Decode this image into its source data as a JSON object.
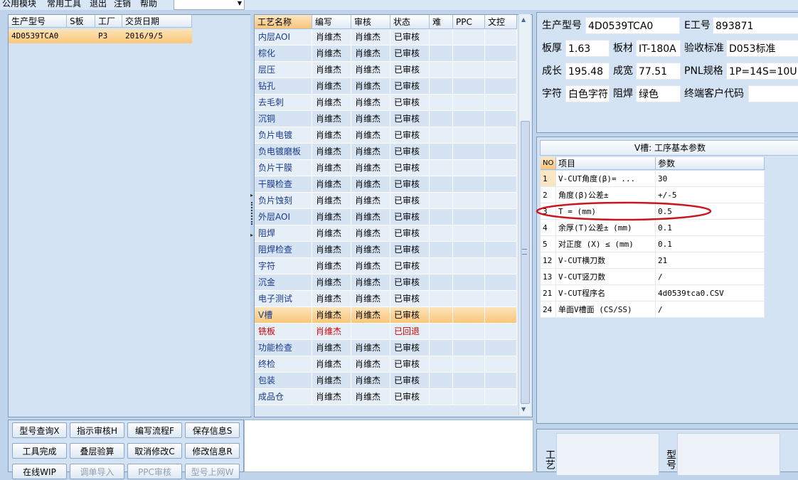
{
  "menubar": {
    "items": [
      "公用模块",
      "常用工具",
      "退出",
      "注销",
      "帮助"
    ],
    "combo_value": ""
  },
  "left_grid": {
    "headers": [
      "生产型号",
      "S板",
      "工厂",
      "交货日期"
    ],
    "rows": [
      {
        "model": "4D0539TCA0",
        "s": "",
        "factory": "P3",
        "date": "2016/9/5"
      }
    ]
  },
  "process_grid": {
    "headers": [
      "工艺名称",
      "编写",
      "审核",
      "状态",
      "难",
      "PPC",
      "文控"
    ],
    "rows": [
      {
        "name": "内层AOI",
        "writer": "肖维杰",
        "reviewer": "肖维杰",
        "status": "已审核"
      },
      {
        "name": "棕化",
        "writer": "肖维杰",
        "reviewer": "肖维杰",
        "status": "已审核"
      },
      {
        "name": "层压",
        "writer": "肖维杰",
        "reviewer": "肖维杰",
        "status": "已审核"
      },
      {
        "name": "钻孔",
        "writer": "肖维杰",
        "reviewer": "肖维杰",
        "status": "已审核"
      },
      {
        "name": "去毛刺",
        "writer": "肖维杰",
        "reviewer": "肖维杰",
        "status": "已审核"
      },
      {
        "name": "沉铜",
        "writer": "肖维杰",
        "reviewer": "肖维杰",
        "status": "已审核"
      },
      {
        "name": "负片电镀",
        "writer": "肖维杰",
        "reviewer": "肖维杰",
        "status": "已审核"
      },
      {
        "name": "负电镀磨板",
        "writer": "肖维杰",
        "reviewer": "肖维杰",
        "status": "已审核"
      },
      {
        "name": "负片干膜",
        "writer": "肖维杰",
        "reviewer": "肖维杰",
        "status": "已审核"
      },
      {
        "name": "干膜检查",
        "writer": "肖维杰",
        "reviewer": "肖维杰",
        "status": "已审核"
      },
      {
        "name": "负片蚀刻",
        "writer": "肖维杰",
        "reviewer": "肖维杰",
        "status": "已审核"
      },
      {
        "name": "外层AOI",
        "writer": "肖维杰",
        "reviewer": "肖维杰",
        "status": "已审核"
      },
      {
        "name": "阻焊",
        "writer": "肖维杰",
        "reviewer": "肖维杰",
        "status": "已审核"
      },
      {
        "name": "阻焊检查",
        "writer": "肖维杰",
        "reviewer": "肖维杰",
        "status": "已审核"
      },
      {
        "name": "字符",
        "writer": "肖维杰",
        "reviewer": "肖维杰",
        "status": "已审核"
      },
      {
        "name": "沉金",
        "writer": "肖维杰",
        "reviewer": "肖维杰",
        "status": "已审核"
      },
      {
        "name": "电子测试",
        "writer": "肖维杰",
        "reviewer": "肖维杰",
        "status": "已审核"
      },
      {
        "name": "V槽",
        "writer": "肖维杰",
        "reviewer": "肖维杰",
        "status": "已审核"
      },
      {
        "name": "铣板",
        "writer": "肖维杰",
        "reviewer": "",
        "status": "已回退"
      },
      {
        "name": "功能检查",
        "writer": "肖维杰",
        "reviewer": "肖维杰",
        "status": "已审核"
      },
      {
        "name": "终检",
        "writer": "肖维杰",
        "reviewer": "肖维杰",
        "status": "已审核"
      },
      {
        "name": "包装",
        "writer": "肖维杰",
        "reviewer": "肖维杰",
        "status": "已审核"
      },
      {
        "name": "成品仓",
        "writer": "肖维杰",
        "reviewer": "肖维杰",
        "status": "已审核"
      }
    ]
  },
  "info": {
    "model_label": "生产型号",
    "model_value": "4D0539TCA0",
    "eno_label": "E工号",
    "eno_value": "893871",
    "thickness_label": "板厚",
    "thickness_value": "1.63",
    "material_label": "板材",
    "material_value": "IT-180A",
    "standard_label": "验收标准",
    "standard_value": "D053标准",
    "length_label": "成长",
    "length_value": "195.48",
    "width_label": "成宽",
    "width_value": "77.51",
    "pnl_label": "PNL规格",
    "pnl_value": "1P=14S=10U",
    "char_label": "字符",
    "char_value": "白色字符",
    "mask_label": "阻焊",
    "mask_value": "绿色",
    "customer_label": "终端客户代码",
    "customer_value": ""
  },
  "params": {
    "title": "V槽: 工序基本参数",
    "headers": [
      "NO",
      "项目",
      "参数"
    ],
    "rows": [
      {
        "no": "1",
        "item": "V-CUT角度(β)= ...",
        "value": "30"
      },
      {
        "no": "2",
        "item": "角度(β)公差±",
        "value": "+/-5"
      },
      {
        "no": "3",
        "item": "T =  (mm)",
        "value": "0.5"
      },
      {
        "no": "4",
        "item": "余厚(T)公差±  (mm)",
        "value": "0.1"
      },
      {
        "no": "5",
        "item": "对正度 (X) ≤ (mm)",
        "value": "0.1"
      },
      {
        "no": "12",
        "item": "V-CUT横刀数",
        "value": "21"
      },
      {
        "no": "13",
        "item": "V-CUT竖刀数",
        "value": "/"
      },
      {
        "no": "21",
        "item": "V-CUT程序名",
        "value": "4d0539tca0.CSV"
      },
      {
        "no": "24",
        "item": "单面V槽面 (CS/SS)",
        "value": "/"
      }
    ]
  },
  "buttons": {
    "row1": [
      "型号查询X",
      "指示审核H",
      "编写流程F",
      "保存信息S"
    ],
    "row2": [
      "工具完成",
      "叠层验算",
      "取消修改C",
      "修改信息R"
    ],
    "row3": [
      "在线WIP",
      "调单导入",
      "PPC审核",
      "型号上网W"
    ]
  },
  "bottom": {
    "label1": "工艺",
    "label2": "型号"
  },
  "colors": {
    "selection": "#fbc77a",
    "annotation": "#c8161d",
    "rejected": "#d10000"
  }
}
